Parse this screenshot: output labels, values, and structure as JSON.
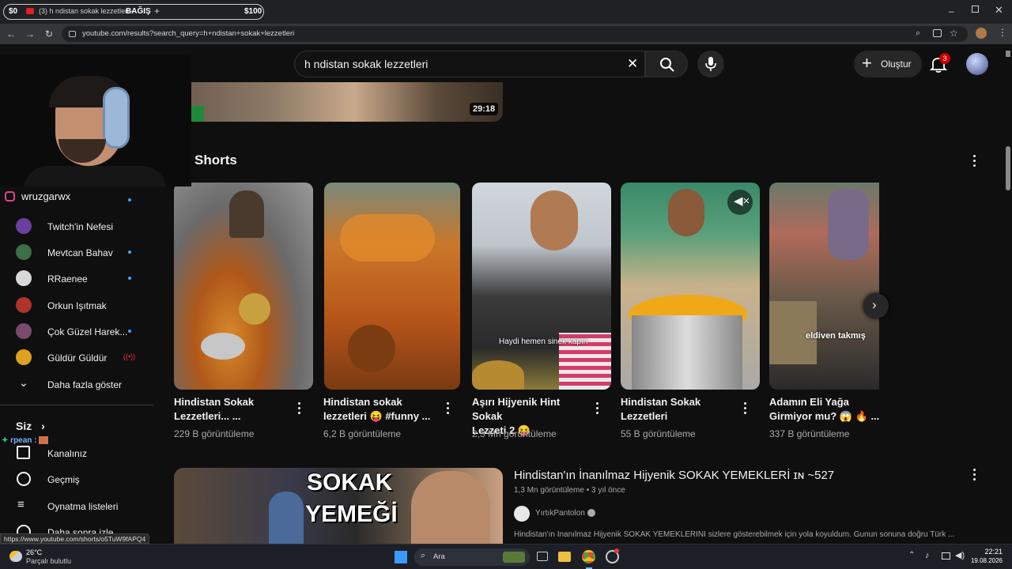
{
  "browser": {
    "tab": {
      "left_amount": "$0",
      "title": "(3) h ndistan sokak lezzetleri -",
      "donate_label": "BAĞIŞ",
      "right_amount": "$100"
    },
    "url": "youtube.com/results?search_query=h+ndistan+sokak+lezzetleri"
  },
  "youtube": {
    "search_query": "h ndistan sokak lezzetleri",
    "create_label": "Oluştur",
    "notification_count": "3",
    "top_video_duration": "29:18",
    "shorts_heading": "Shorts",
    "shorts": [
      {
        "title_line1": "Hindistan Sokak",
        "title_line2": "Lezzetleri... ...",
        "views": "229 B görüntüleme"
      },
      {
        "title_line1": "Hindistan sokak",
        "title_line2": "lezzetleri 😝 #funny ...",
        "views": "6,2 B görüntüleme"
      },
      {
        "title_line1": "Aşırı Hijyenik Hint Sokak",
        "title_line2": "Lezzeti 2 😝",
        "views": "2,3 Mn görüntüleme",
        "overlay": "Haydi hemen sinek kapın"
      },
      {
        "title_line1": "Hindistan Sokak",
        "title_line2": "Lezzetleri",
        "views": "55 B görüntüleme"
      },
      {
        "title_line1": "Adamın Eli Yağa",
        "title_line2": "Girmiyor mu? 😱 🔥 ...",
        "views": "337 B görüntüleme",
        "overlay": "eldiven takmış"
      }
    ],
    "video": {
      "title": "Hindistan'ın İnanılmaz Hijyenik SOKAK YEMEKLERİ ɪɴ ~527",
      "meta": "1,3 Mn görüntüleme • 3 yıl önce",
      "channel": "YırtıkPantolon",
      "description": "Hindistan'ın İnanılmaz Hijyenik SOKAK YEMEKLERİNİ sizlere gösterebilmek için yola koyuldum. Gunun sonuna doğru Türk ...",
      "thumb_text_1": "SOKAK",
      "thumb_text_2": "YEMEĞİ"
    }
  },
  "sidebar": {
    "stream_user": "wruzgarwx",
    "subscriptions": [
      {
        "name": "Twitch'in Nefesi",
        "live": false,
        "color": "#6b3fa0"
      },
      {
        "name": "Mevtcan Bahav",
        "live": true,
        "color": "#3c6e47"
      },
      {
        "name": "RRaenee",
        "live": true,
        "color": "#d8d8d8"
      },
      {
        "name": "Orkun Işıtmak",
        "live": false,
        "color": "#b0322b"
      },
      {
        "name": "Çok Güzel Harek...",
        "live": true,
        "color": "#7a4a6a"
      },
      {
        "name": "Güldür Güldür",
        "live": false,
        "color": "#e0a020",
        "broadcast": "((•))"
      }
    ],
    "show_more": "Daha fazla göster",
    "you_label": "Siz",
    "chat_user": "rpean :",
    "you_items": [
      "Kanalınız",
      "Geçmiş",
      "Oynatma listeleri",
      "Daha sonra izle"
    ]
  },
  "status_url": "https://www.youtube.com/shorts/o5TuW9fAPQ4",
  "taskbar": {
    "temperature": "26°C",
    "weather": "Parçalı bulutlu",
    "search_placeholder": "Ara",
    "time": "22:21",
    "date": "19.08.2026"
  }
}
